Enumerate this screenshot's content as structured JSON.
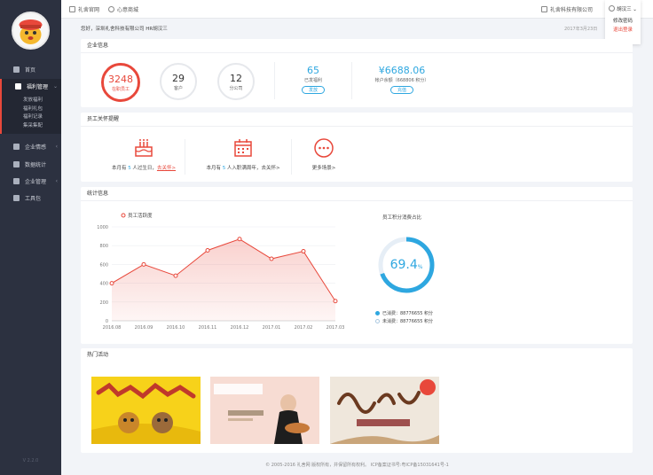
{
  "topbar": {
    "link1": "礼舍官网",
    "link2": "心意商城",
    "company": "礼舍科技有限公司",
    "user": "胡汉三 ⌄"
  },
  "usermenu": {
    "item1": "修改密码",
    "item2": "退出登录"
  },
  "greeting": "您好，深圳礼舍科技有限公司 HR胡汉三",
  "date": "2017年3月23日",
  "sidebar": {
    "items": [
      {
        "label": "首页"
      },
      {
        "label": "福利管理"
      },
      {
        "label": "企业情感"
      },
      {
        "label": "数据统计"
      },
      {
        "label": "企业管理"
      },
      {
        "label": "工具包"
      }
    ],
    "sub": [
      {
        "label": "发放福利"
      },
      {
        "label": "福利礼包"
      },
      {
        "label": "福利记录"
      },
      {
        "label": "集采集配"
      }
    ],
    "version": "V 2.2.0"
  },
  "company": {
    "title": "企业信息",
    "employees": {
      "value": "3248",
      "label": "在职员工"
    },
    "customers": {
      "value": "29",
      "label": "客户"
    },
    "branches": {
      "value": "12",
      "label": "分公司"
    },
    "issued": {
      "value": "65",
      "label": "已发福利",
      "button": "发放"
    },
    "balance": {
      "value": "¥6688.06",
      "label": "帐户余额（668806 积分）",
      "button": "充值"
    }
  },
  "care": {
    "title": "员工关怀提醒",
    "birthday": {
      "pre": "本月有 ",
      "n": "5",
      "mid": " 人过生日，",
      "link": "去关怀>"
    },
    "anniversary": {
      "pre": "本月有 ",
      "n": "5",
      "mid": " 人入职满周年，",
      "link": "去关怀>"
    },
    "more": "更多场景>"
  },
  "stats": {
    "title": "统计信息",
    "legend": "员工活跃度",
    "donut_title": "员工积分消费占比",
    "donut_value": "69.4",
    "donut_unit": "%",
    "consumed": "已消费：88776655 积分",
    "unconsumed": "未消费：88776655 积分",
    "donut_color": "#2ea7e0"
  },
  "chart_data": {
    "type": "area",
    "x": [
      "2016.08",
      "2016.09",
      "2016.10",
      "2016.11",
      "2016.12",
      "2017.01",
      "2017.02",
      "2017.03"
    ],
    "series": [
      {
        "name": "员工活跃度",
        "values": [
          400,
          600,
          480,
          750,
          870,
          660,
          740,
          210
        ]
      }
    ],
    "ylim": [
      0,
      1000
    ],
    "yticks": [
      0,
      200,
      400,
      600,
      800,
      1000
    ],
    "color": "#e8483b"
  },
  "events": {
    "title": "热门活动"
  },
  "footer": "© 2005-2016 礼舍网 版权所有，并保留所有权利。 ICP备案证书号:粤ICP备15031641号-1"
}
